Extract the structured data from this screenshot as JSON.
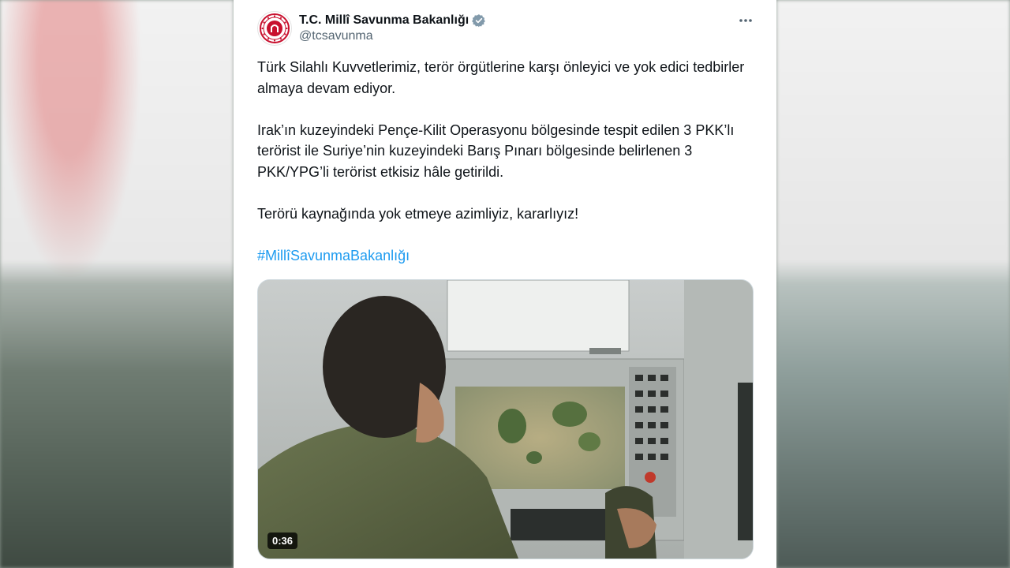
{
  "account": {
    "display_name": "T.C. Millî Savunma Bakanlığı",
    "handle": "@tcsavunma",
    "verified_color": "#829aab"
  },
  "tweet": {
    "paragraphs": [
      "Türk Silahlı Kuvvetlerimiz, terör örgütlerine karşı önleyici ve yok edici tedbirler almaya devam ediyor.",
      "Irak’ın kuzeyindeki Pençe-Kilit Operasyonu bölgesinde tespit edilen 3 PKK’lı terörist ile Suriye’nin kuzeyindeki Barış Pınarı bölgesinde belirlenen 3 PKK/YPG’li terörist etkisiz hâle getirildi.",
      "Terörü kaynağında yok etmeye azimliyiz, kararlıyız!"
    ],
    "hashtag": "#MillîSavunmaBakanlığı"
  },
  "video": {
    "duration": "0:36"
  },
  "icons": {
    "more": "more-horizontal-icon",
    "verified": "verified-badge-icon",
    "avatar": "ministry-emblem-icon"
  },
  "colors": {
    "hashtag": "#1d9bf0",
    "text": "#0f1419",
    "secondary": "#536471"
  }
}
